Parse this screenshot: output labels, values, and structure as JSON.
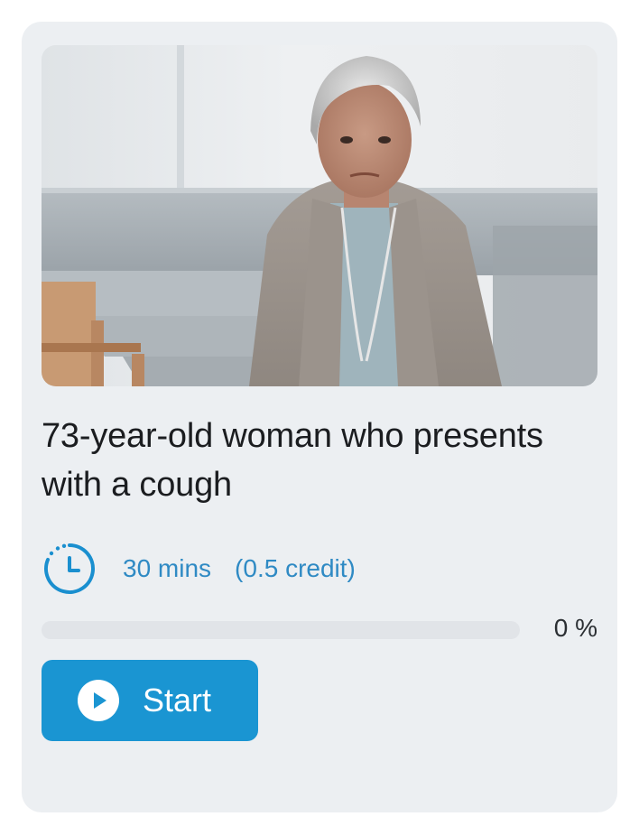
{
  "card": {
    "image_subject": "elderly woman seated in a waiting room",
    "title": "73-year-old woman who presents with a cough",
    "duration": "30 mins",
    "credit": "(0.5 credit)",
    "duration_icon": "clock-icon",
    "progress": {
      "value_percent": 0,
      "label": "0 %"
    },
    "start_button": {
      "label": "Start",
      "icon": "play-icon"
    }
  },
  "colors": {
    "card_background": "#eceff2",
    "accent": "#1a95d2",
    "meta_text": "#2f8ac4",
    "title_text": "#1b1d20",
    "track": "#e1e4e8"
  }
}
